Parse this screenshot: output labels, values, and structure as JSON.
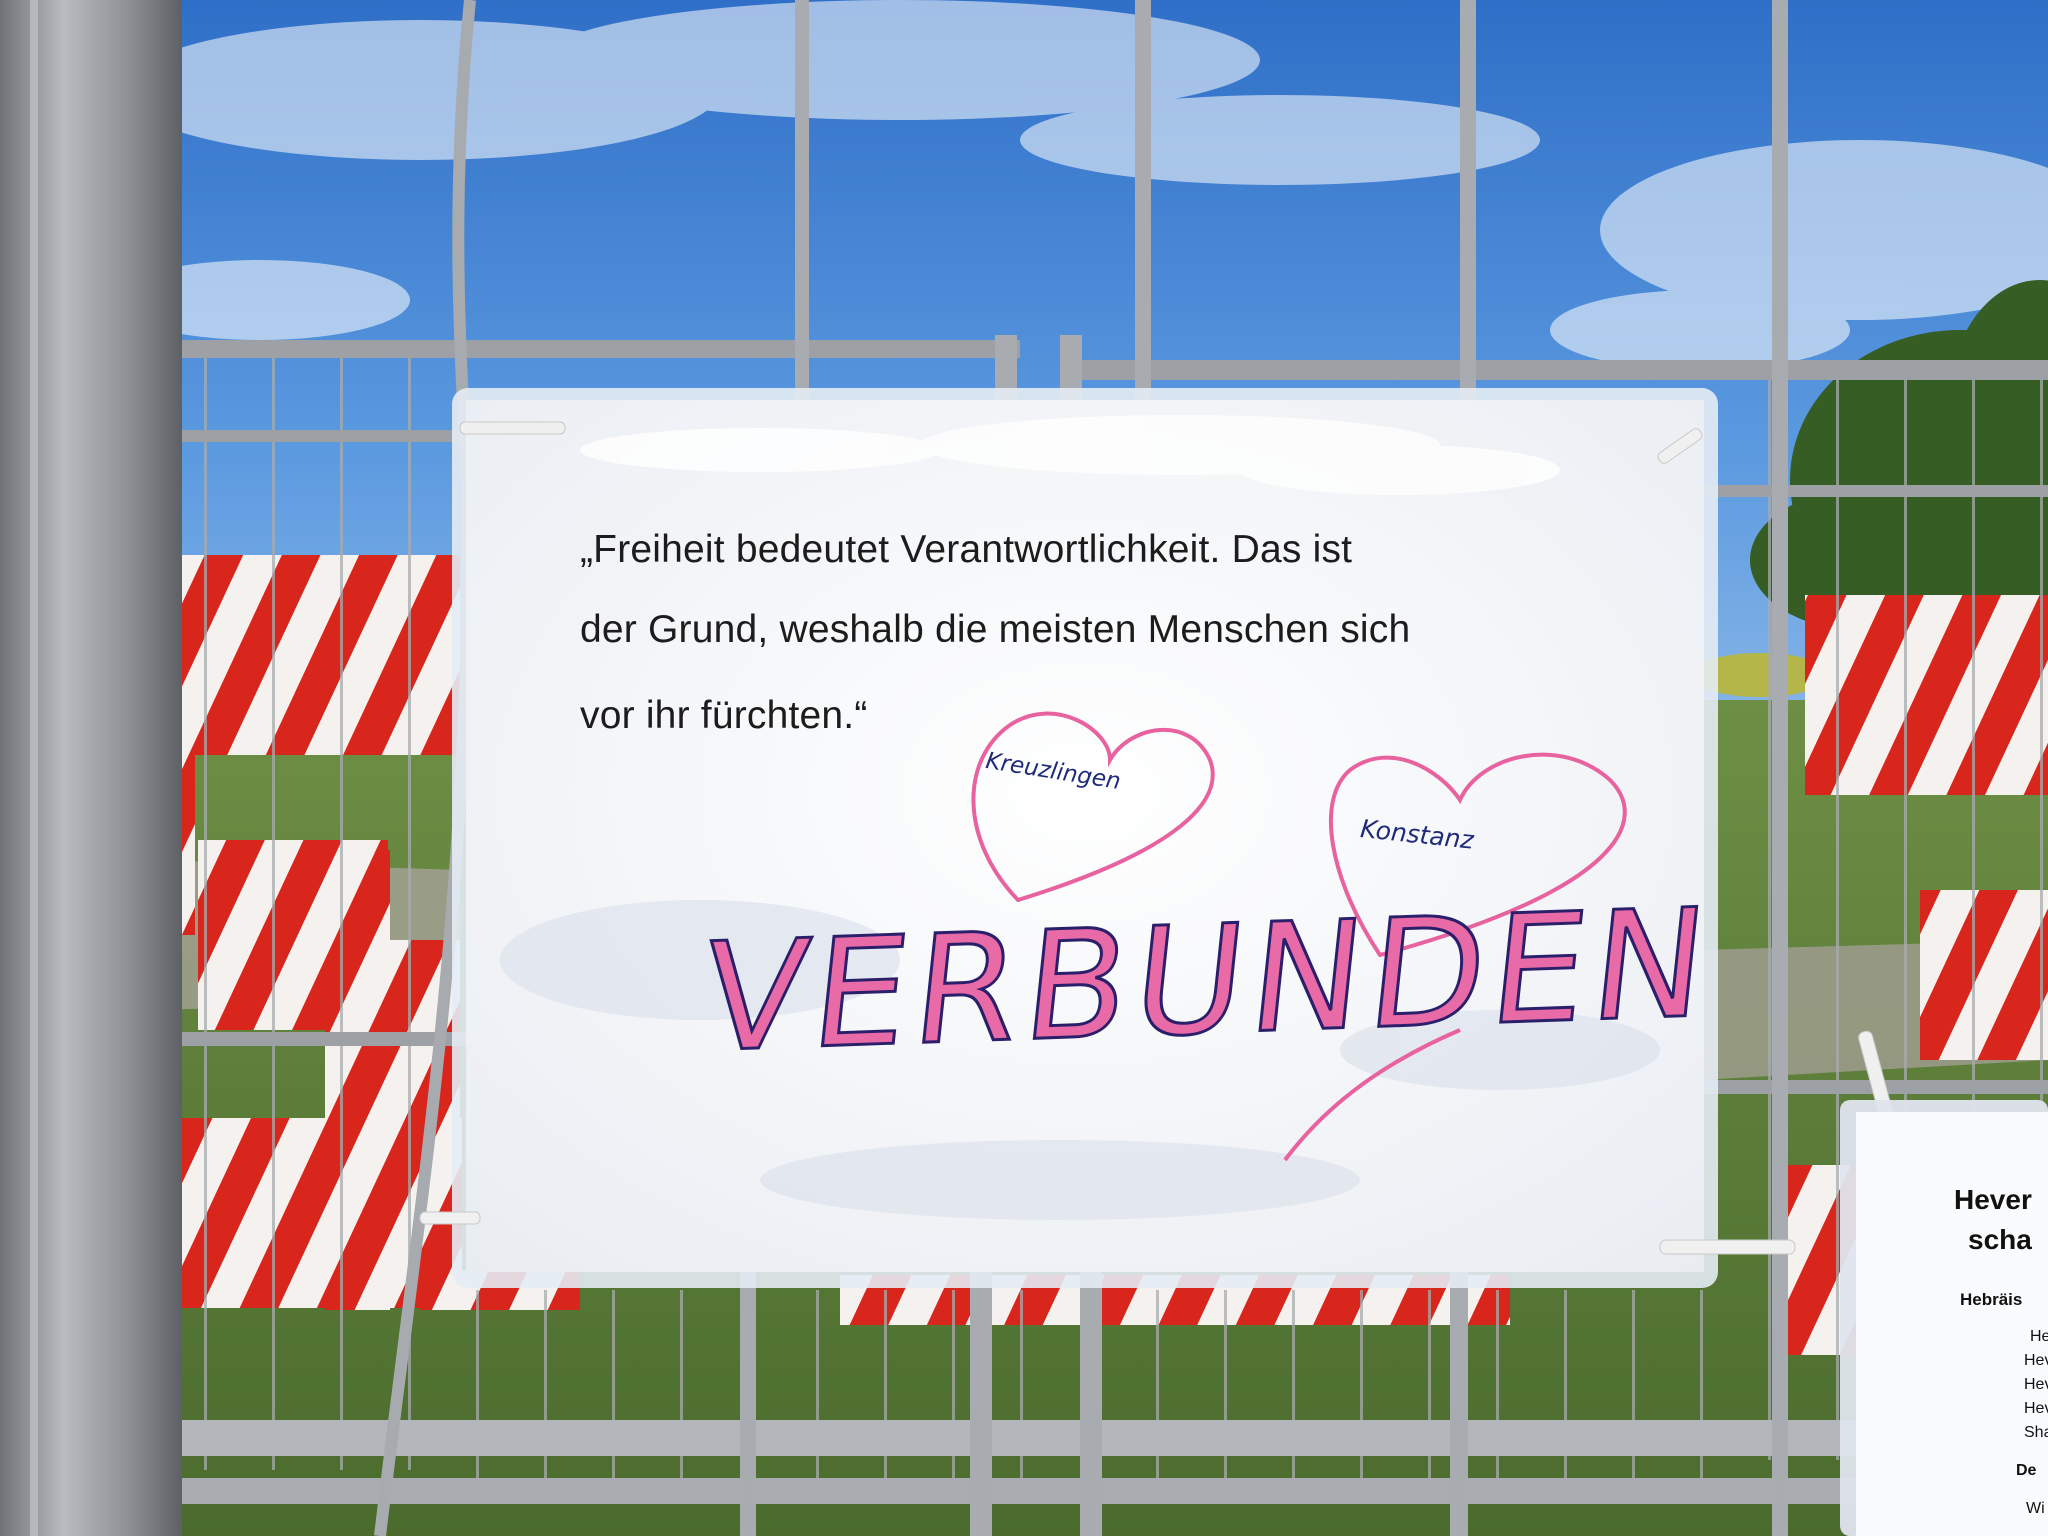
{
  "sign": {
    "quote_line1": "„Freiheit bedeutet Verantwortlichkeit. Das ist",
    "quote_line2": "der Grund, weshalb die meisten Menschen sich",
    "quote_line3": "vor ihr fürchten.“",
    "heart_left_text": "Kreuzlingen",
    "heart_right_text": "Konstanz",
    "headline": "VERBUNDEN"
  },
  "side_sign": {
    "line1": "Hever",
    "line2": "scha",
    "line3": "Hebräis",
    "list": [
      "Hever",
      "Hever",
      "Hever",
      "Hever",
      "Sha"
    ],
    "line4": "De",
    "line5": "Wi"
  },
  "colors": {
    "sky": "#3b7fd4",
    "grass": "#5a7d3a",
    "tape_red": "#d8261c",
    "fence": "#9a9ea2",
    "marker_pink": "#e86aa6",
    "marker_blue": "#2b1f6b"
  },
  "icons": [
    "heart-icon",
    "heart-icon",
    "cable-tie-icon"
  ]
}
